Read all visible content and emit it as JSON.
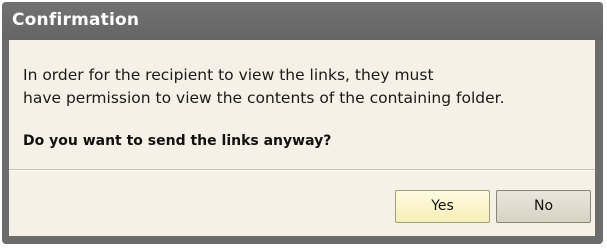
{
  "dialog": {
    "title": "Confirmation",
    "message_line1": "In order for the recipient to view the links, they must",
    "message_line2": "have permission to view the contents of the containing folder.",
    "question": "Do you want to send the links anyway?",
    "buttons": {
      "yes_label": "Yes",
      "no_label": "No"
    }
  },
  "colors": {
    "titlebar": "#6c6c6c",
    "content_background": "#f5f1e6",
    "yes_button": "#fbf5c8",
    "no_button": "#e0dbcd"
  }
}
